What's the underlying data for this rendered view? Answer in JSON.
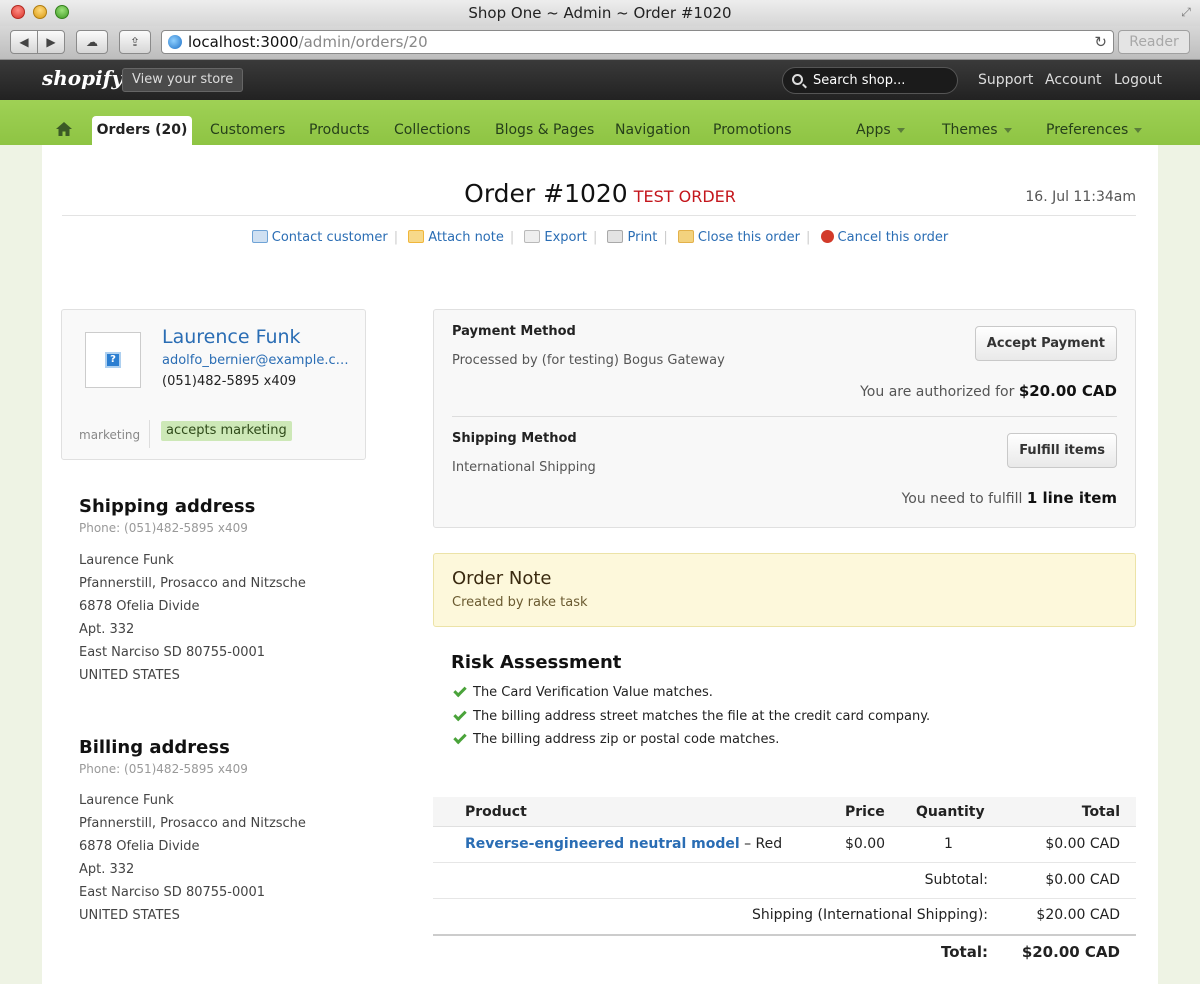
{
  "window": {
    "title": "Shop One ~ Admin ~ Order #1020"
  },
  "browser": {
    "url_host": "localhost:3000",
    "url_path": "/admin/orders/20",
    "reader_label": "Reader"
  },
  "topbar": {
    "logo": "shopify",
    "view_store": "View your store",
    "search_placeholder": "Search shop...",
    "links": [
      "Support",
      "Account",
      "Logout"
    ]
  },
  "nav": {
    "active_tab": "Orders (20)",
    "tabs": [
      "Customers",
      "Products",
      "Collections",
      "Blogs & Pages",
      "Navigation",
      "Promotions"
    ],
    "dropdowns": [
      "Apps",
      "Themes",
      "Preferences"
    ]
  },
  "order": {
    "title": "Order #1020",
    "badge": "TEST ORDER",
    "date": "16. Jul 11:34am"
  },
  "actions": [
    {
      "label": "Contact customer",
      "icon": "envelope-icon",
      "color": "#6fa3d6"
    },
    {
      "label": "Attach note",
      "icon": "note-icon",
      "color": "#f0b63a"
    },
    {
      "label": "Export",
      "icon": "csv-icon",
      "color": "#b9b9b9"
    },
    {
      "label": "Print",
      "icon": "printer-icon",
      "color": "#a9a9a9"
    },
    {
      "label": "Close this order",
      "icon": "lock-icon",
      "color": "#e3b14a"
    },
    {
      "label": "Cancel this order",
      "icon": "cancel-icon",
      "color": "#d23a2a"
    }
  ],
  "customer": {
    "name": "Laurence Funk",
    "email": "adolfo_bernier@example.com",
    "phone": "(051)482-5895 x409",
    "tag_label": "marketing",
    "tag": "accepts marketing"
  },
  "shipping": {
    "heading": "Shipping address",
    "phone": "Phone: (051)482-5895 x409",
    "lines": [
      "Laurence Funk",
      "Pfannerstill, Prosacco and Nitzsche",
      "6878 Ofelia Divide",
      "Apt. 332",
      "East Narciso SD 80755-0001",
      "UNITED STATES"
    ]
  },
  "billing": {
    "heading": "Billing address",
    "phone": "Phone: (051)482-5895 x409",
    "lines": [
      "Laurence Funk",
      "Pfannerstill, Prosacco and Nitzsche",
      "6878 Ofelia Divide",
      "Apt. 332",
      "East Narciso SD 80755-0001",
      "UNITED STATES"
    ]
  },
  "payment": {
    "heading": "Payment Method",
    "sub": "Processed by (for testing) Bogus Gateway",
    "button": "Accept Payment",
    "status_prefix": "You are authorized for",
    "status_amount": "$20.00 CAD"
  },
  "shipping_method": {
    "heading": "Shipping Method",
    "sub": "International Shipping",
    "button": "Fulfill items",
    "status_prefix": "You need to fulfill",
    "status_amount": "1 line item"
  },
  "note": {
    "title": "Order Note",
    "sub": "Created by rake task"
  },
  "risk": {
    "title": "Risk Assessment",
    "items": [
      "The Card Verification Value matches.",
      "The billing address street matches the file at the credit card company.",
      "The billing address zip or postal code matches."
    ]
  },
  "items_table": {
    "headers": {
      "product": "Product",
      "price": "Price",
      "quantity": "Quantity",
      "total": "Total"
    },
    "rows": [
      {
        "product": "Reverse-engineered neutral model",
        "variant": " – Red",
        "price": "$0.00",
        "quantity": "1",
        "total": "$0.00 CAD"
      }
    ],
    "subtotal_label": "Subtotal:",
    "subtotal": "$0.00 CAD",
    "shipping_label": "Shipping (International Shipping):",
    "shipping": "$20.00 CAD",
    "total_label": "Total:",
    "total": "$20.00 CAD"
  }
}
